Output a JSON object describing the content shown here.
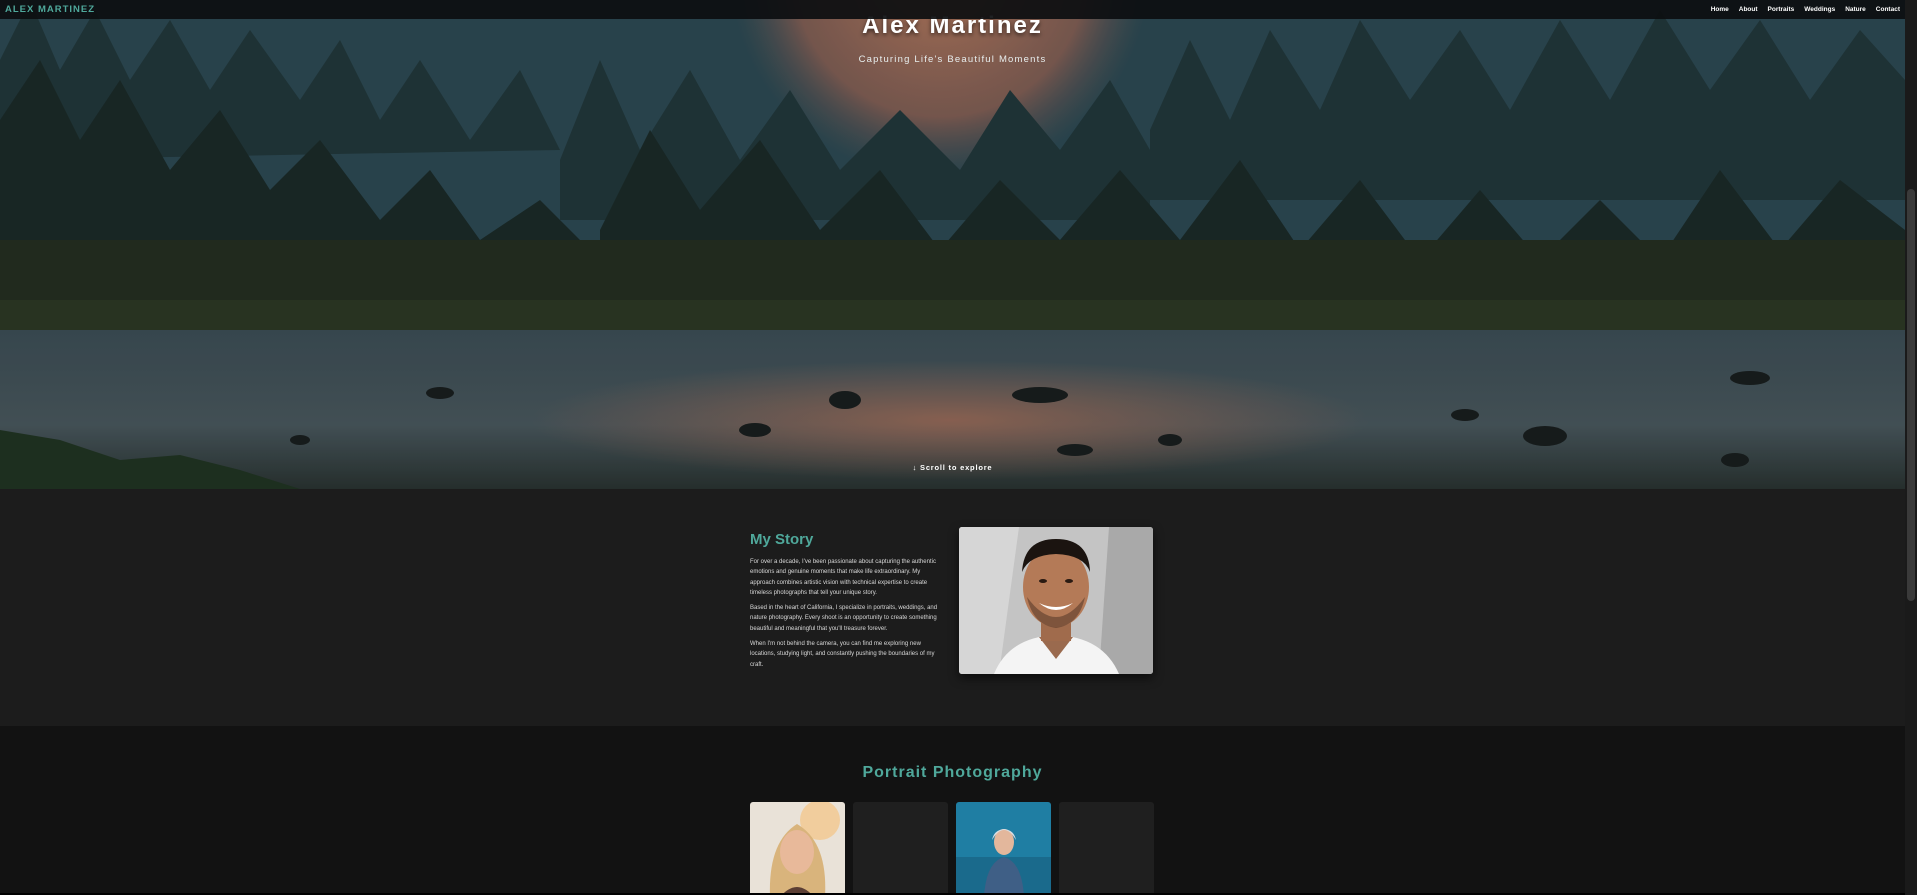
{
  "brand": "ALEX MARTINEZ",
  "nav": {
    "items": [
      {
        "label": "Home"
      },
      {
        "label": "About"
      },
      {
        "label": "Portraits"
      },
      {
        "label": "Weddings"
      },
      {
        "label": "Nature"
      },
      {
        "label": "Contact"
      }
    ]
  },
  "hero": {
    "title": "Alex Martinez",
    "subtitle": "Capturing Life's Beautiful Moments",
    "scroll_cue": "↓ Scroll to explore"
  },
  "about": {
    "heading": "My Story",
    "paragraphs": [
      "For over a decade, I've been passionate about capturing the authentic emotions and genuine moments that make life extraordinary. My approach combines artistic vision with technical expertise to create timeless photographs that tell your unique story.",
      "Based in the heart of California, I specialize in portraits, weddings, and nature photography. Every shoot is an opportunity to create something beautiful and meaningful that you'll treasure forever.",
      "When I'm not behind the camera, you can find me exploring new locations, studying light, and constantly pushing the boundaries of my craft."
    ]
  },
  "portfolio": {
    "title": "Portrait Photography"
  },
  "colors": {
    "accent": "#4fa89b",
    "nav_bg": "#0c0e10",
    "about_bg": "#1c1c1c",
    "portfolio_bg": "#121212",
    "card_bg": "#1f1f1f"
  }
}
